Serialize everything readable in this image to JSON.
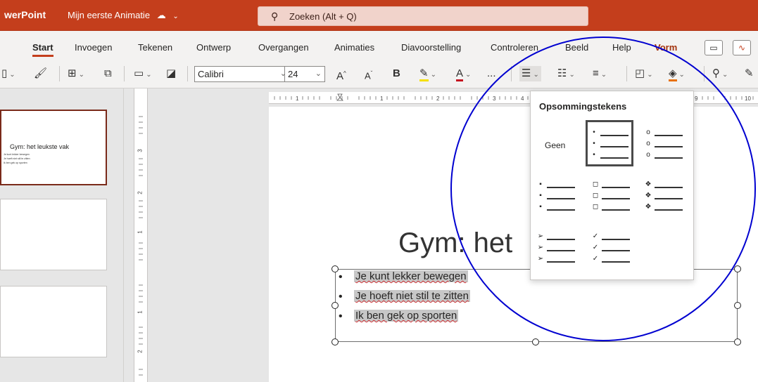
{
  "titlebar": {
    "app_name": "werPoint",
    "doc_name": "Mijn eerste Animatie",
    "search_placeholder": "Zoeken (Alt + Q)"
  },
  "tabs": [
    "Start",
    "Invoegen",
    "Tekenen",
    "Ontwerp",
    "Overgangen",
    "Animaties",
    "Diavoorstelling",
    "Controleren",
    "Beeld",
    "Help",
    "Vorm"
  ],
  "active_tab": "Start",
  "toolbar": {
    "font_name": "Calibri",
    "font_size": "24",
    "bold_label": "B",
    "grow_font": "A",
    "shrink_font": "A",
    "more": "..."
  },
  "thumbnails": [
    {
      "title": "Gym: het leukste vak",
      "lines": [
        "Je kunt lekker bewegen",
        "Je hoeft niet stil te zitten",
        "Ik ben gek op sporten"
      ]
    },
    {},
    {}
  ],
  "slide": {
    "title": "Gym: het",
    "bullets": [
      "Je kunt lekker bewegen",
      "Je hoeft niet stil te zitten",
      "Ik ben gek op sporten"
    ]
  },
  "bullet_panel": {
    "title": "Opsommingstekens",
    "none_label": "Geen",
    "options": [
      {
        "name": "none"
      },
      {
        "name": "filled-round",
        "marker": "•",
        "selected": true
      },
      {
        "name": "hollow-round",
        "marker": "o"
      },
      {
        "name": "filled-square",
        "marker": "▪"
      },
      {
        "name": "hollow-square",
        "marker": "◻"
      },
      {
        "name": "diamond",
        "marker": "❖"
      },
      {
        "name": "arrow",
        "marker": "➢"
      },
      {
        "name": "checkmark",
        "marker": "✓"
      }
    ]
  },
  "colors": {
    "titlebar": "#c43e1c",
    "highlight_circle": "#0000d0"
  }
}
